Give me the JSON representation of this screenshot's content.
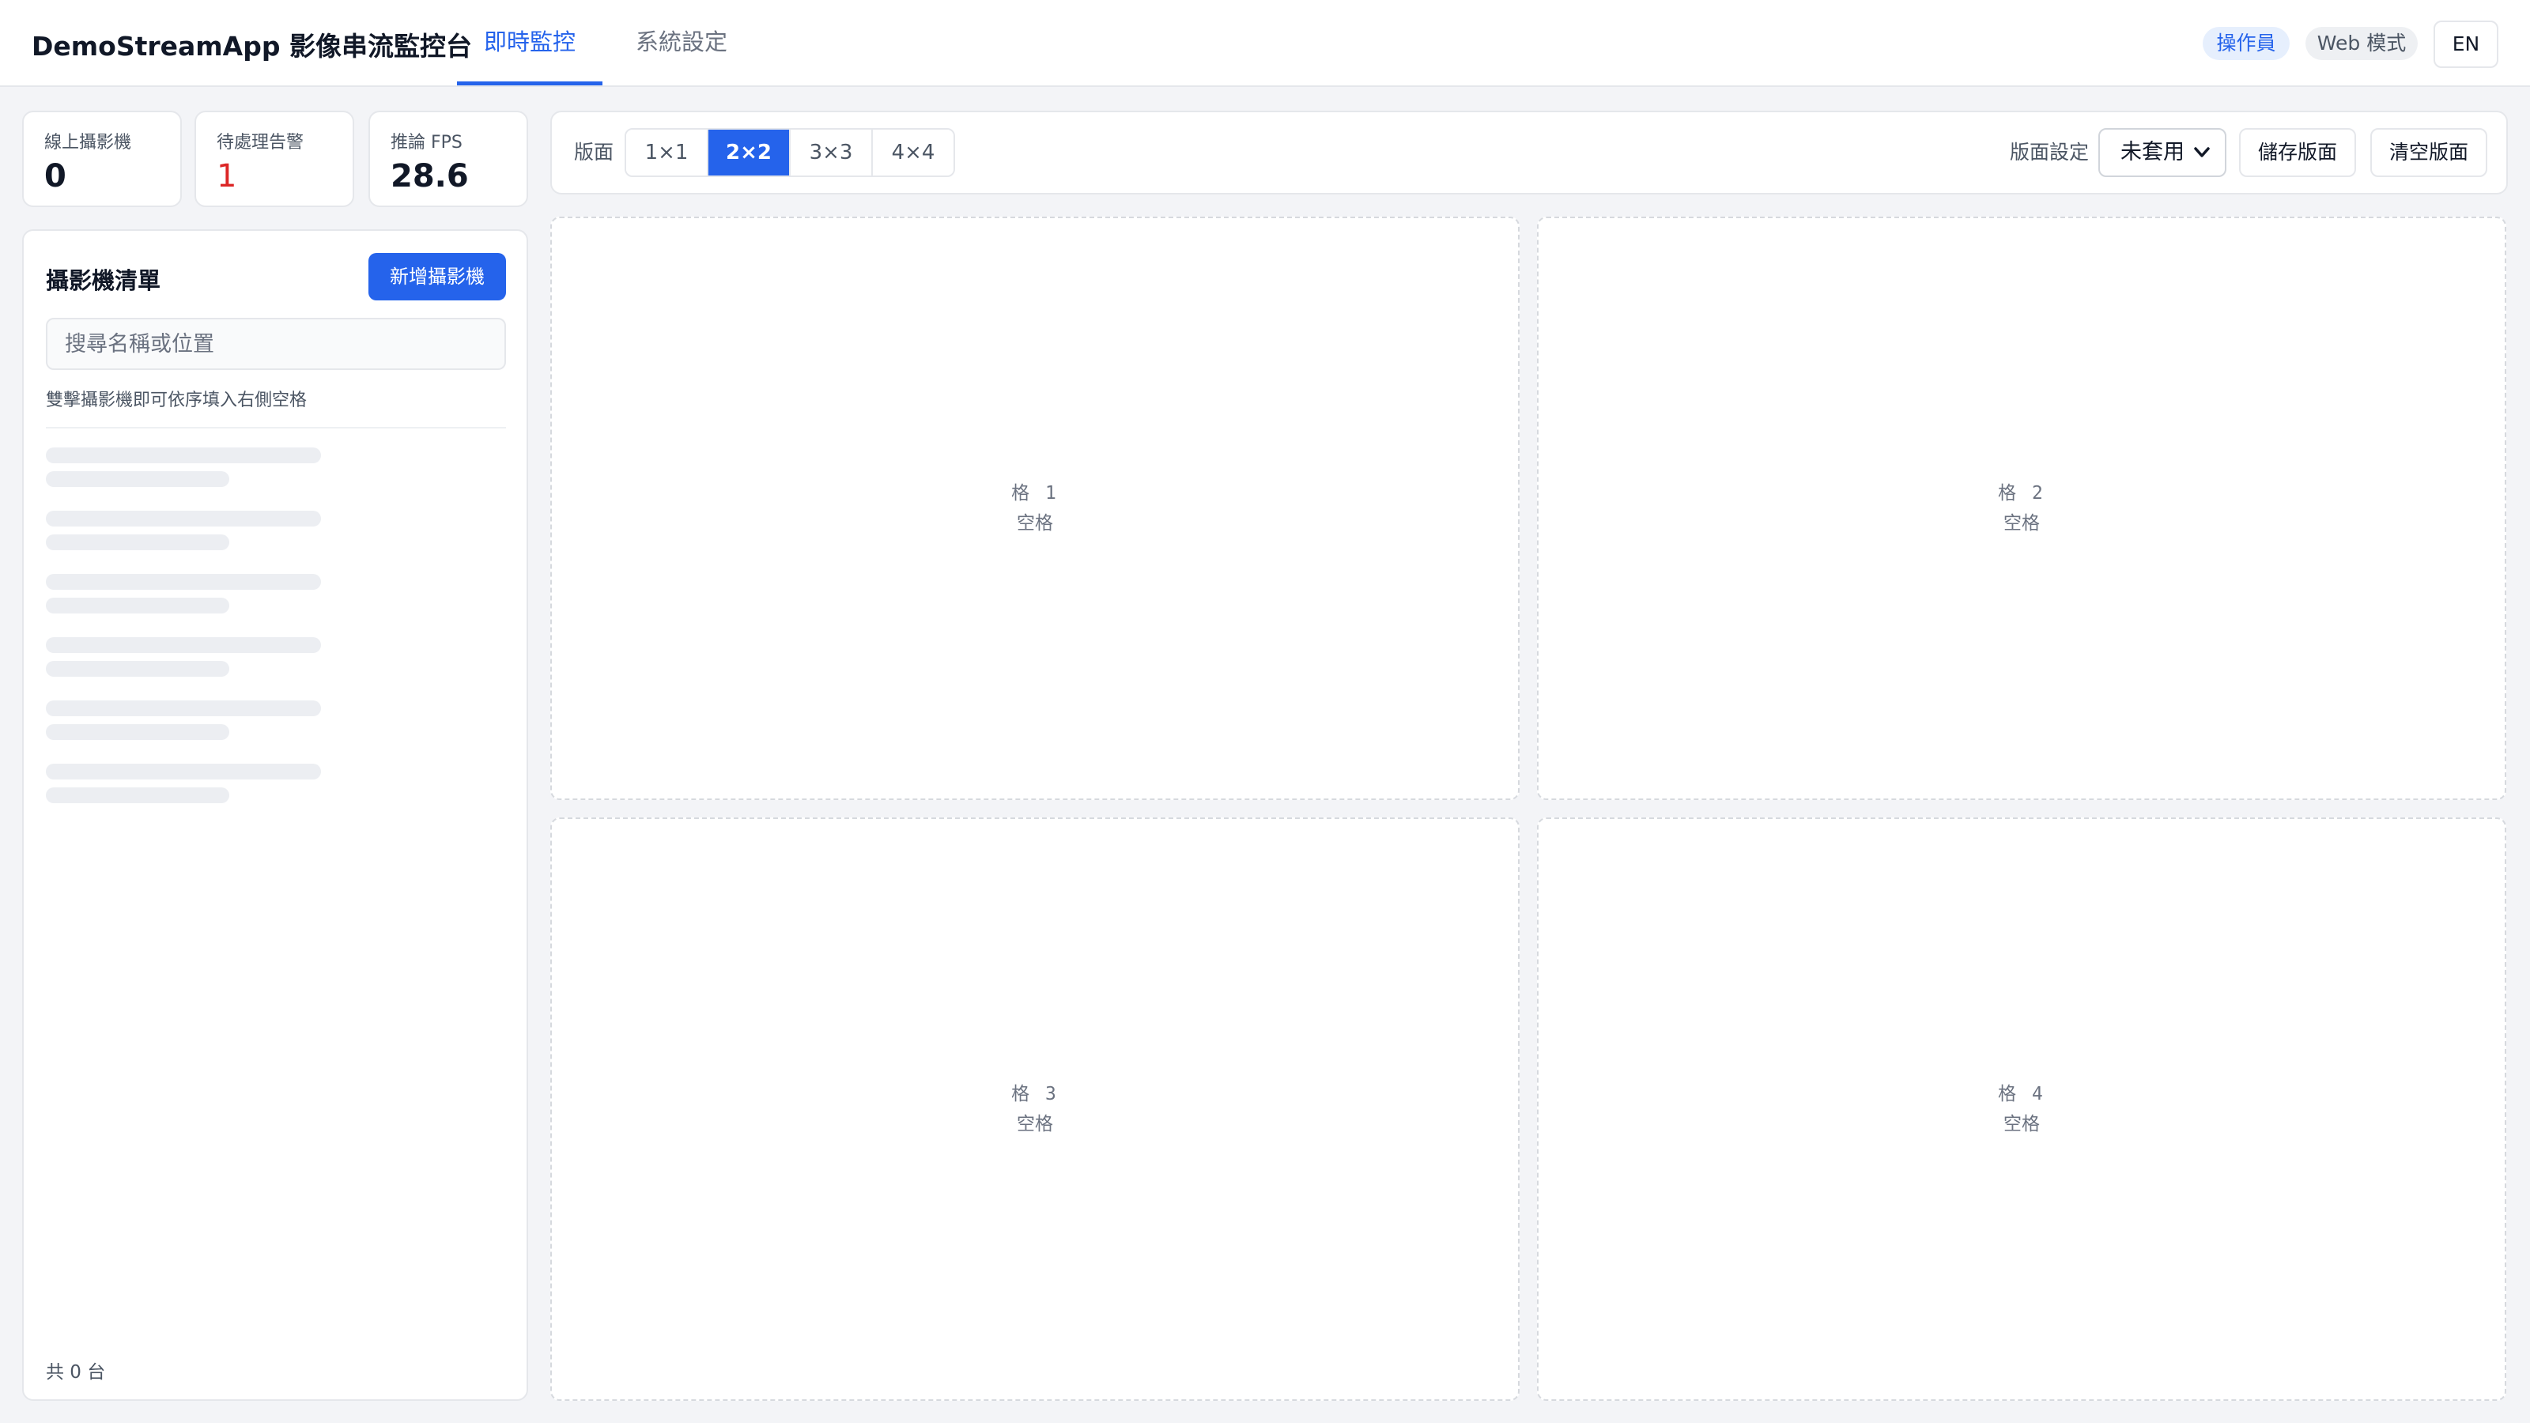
{
  "header": {
    "title": "DemoStreamApp 影像串流監控台",
    "tabs": [
      {
        "label": "即時監控",
        "active": true
      },
      {
        "label": "系統設定",
        "active": false
      }
    ],
    "role_badge": "操作員",
    "mode_badge": "Web 模式",
    "language_button": "EN"
  },
  "stats": [
    {
      "label": "線上攝影機",
      "value": "0"
    },
    {
      "label": "待處理告警",
      "value": "1",
      "color": "#dc2626"
    },
    {
      "label": "推論 FPS",
      "value": "28.6"
    }
  ],
  "camera_panel": {
    "title": "攝影機清單",
    "add_button": "新增攝影機",
    "search": {
      "placeholder": "搜尋名稱或位置",
      "value": ""
    },
    "hint": "雙擊攝影機即可依序填入右側空格",
    "loading_placeholders": 6,
    "count_text": "共 0 台"
  },
  "toolbar": {
    "layout_label": "版面",
    "layouts": [
      "1×1",
      "2×2",
      "3×3",
      "4×4"
    ],
    "selected_layout": "2×2",
    "preset_label": "版面設定",
    "preset_selected": "未套用",
    "save_button": "儲存版面",
    "clear_button": "清空版面"
  },
  "grid": {
    "cells": [
      {
        "label": "格 1",
        "status": "空格"
      },
      {
        "label": "格 2",
        "status": "空格"
      },
      {
        "label": "格 3",
        "status": "空格"
      },
      {
        "label": "格 4",
        "status": "空格"
      }
    ]
  },
  "colors": {
    "accent": "#2563eb",
    "alert": "#dc2626",
    "background": "#f3f4f7"
  }
}
